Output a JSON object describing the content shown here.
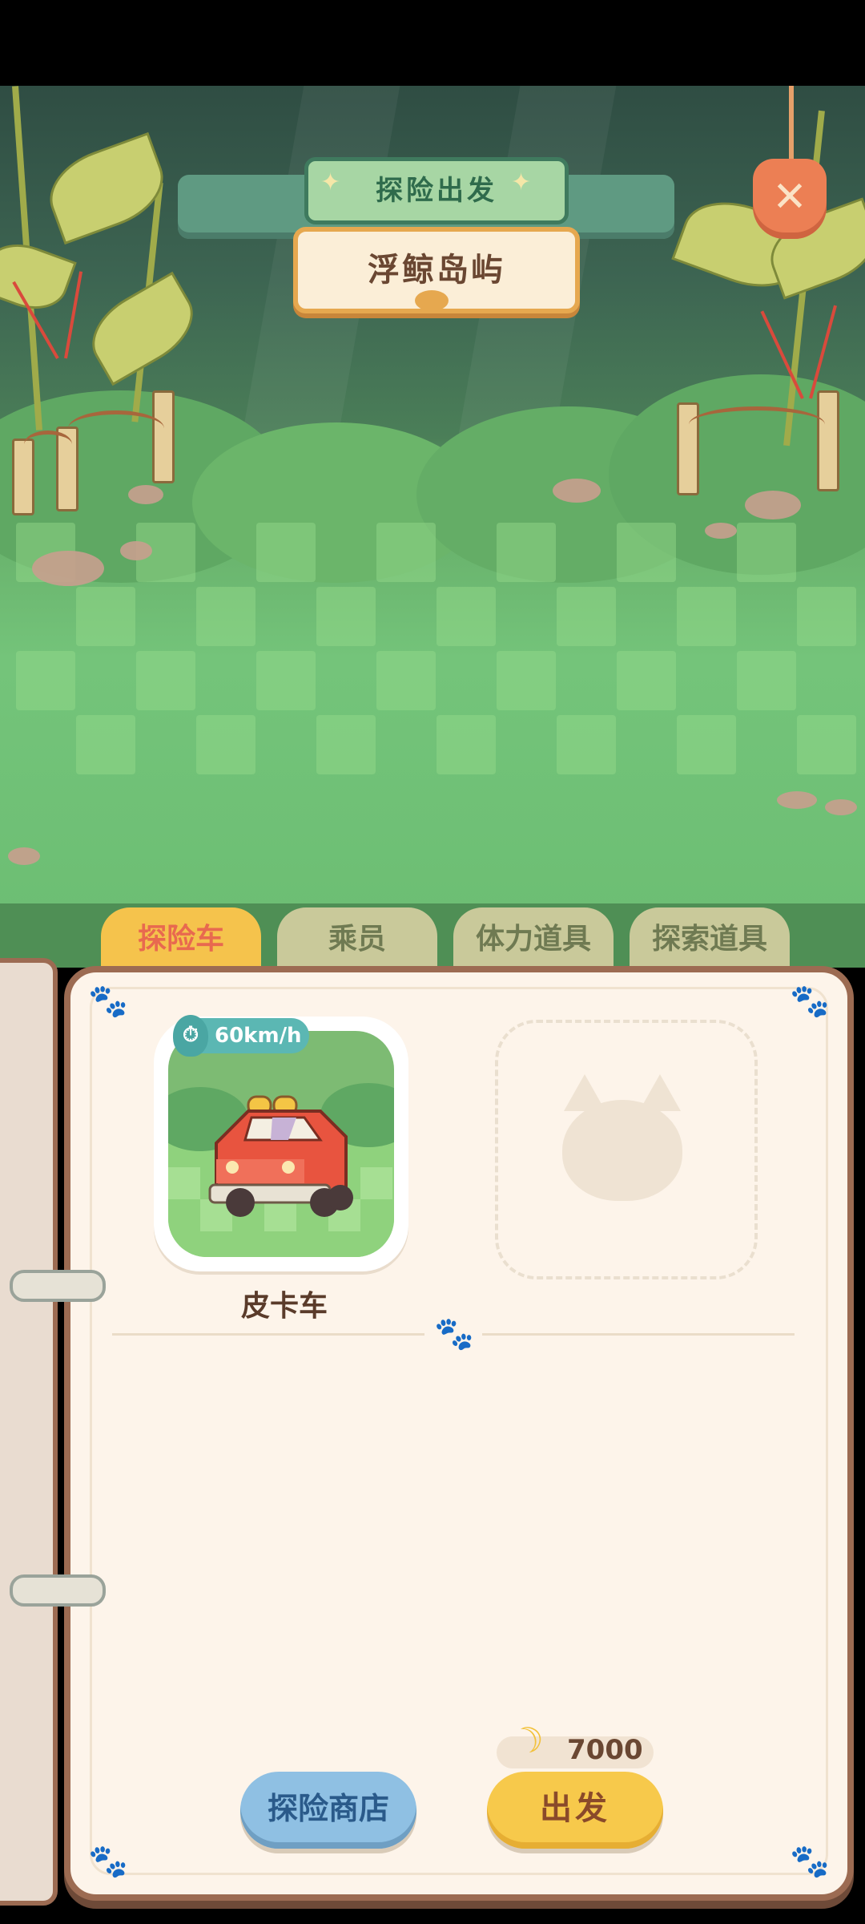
{
  "title_banner": {
    "subtitle": "探险出发",
    "location": "浮鲸岛屿"
  },
  "tabs": [
    {
      "label": "探险车",
      "active": true
    },
    {
      "label": "乘员",
      "active": false
    },
    {
      "label": "体力道具",
      "active": false
    },
    {
      "label": "探索道具",
      "active": false
    }
  ],
  "vehicle": {
    "name": "皮卡车",
    "speed": "60km/h"
  },
  "cost": {
    "amount": "7000",
    "currency_icon": "banana-icon"
  },
  "buttons": {
    "shop": "探险商店",
    "depart": "出发"
  },
  "colors": {
    "active_tab": "#f5c34c",
    "depart_button": "#f7c94b",
    "shop_button": "#8fc0e3"
  }
}
